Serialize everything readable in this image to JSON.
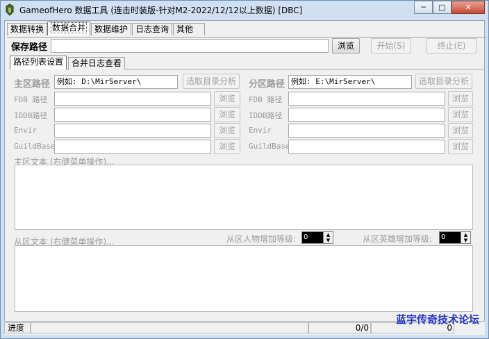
{
  "window": {
    "title": "GameofHero 数据工具 (连击时装版-针对M2-2022/12/12以上数据) [DBC]",
    "controls": {
      "minimize": "─",
      "maximize": "□",
      "close": "✕"
    }
  },
  "main_tabs": [
    "数据转换",
    "数据合并",
    "数据维护",
    "日志查询",
    "其他"
  ],
  "save_path": {
    "label": "保存路径",
    "value": "",
    "browse": "浏览",
    "start": "开始(S)",
    "stop": "终止(E)"
  },
  "sub_tabs": [
    "路径列表设置",
    "合并日志查看"
  ],
  "left": {
    "title": "主区路径",
    "path_value": "例如: D:\\MirServer\\",
    "analyze": "选取目录分析",
    "rows": [
      {
        "label": "FDB 路径",
        "browse": "浏览"
      },
      {
        "label": "IDDB路径",
        "browse": "浏览"
      },
      {
        "label": "Envir",
        "browse": "浏览"
      },
      {
        "label": "GuildBase",
        "browse": "浏览"
      }
    ]
  },
  "right": {
    "title": "分区路径",
    "path_value": "例如: E:\\MirServer\\",
    "analyze": "选取目录分析",
    "rows": [
      {
        "label": "FDB 路径",
        "browse": "浏览"
      },
      {
        "label": "IDDB路径",
        "browse": "浏览"
      },
      {
        "label": "Envir",
        "browse": "浏览"
      },
      {
        "label": "GuildBase",
        "browse": "浏览"
      }
    ]
  },
  "main_text_label": "主区文本 (右健菜单操作)...",
  "sub_text_label": "从区文本 (右健菜单操作)...",
  "player_level_label": "从区人物增加等级:",
  "hero_level_label": "从区英雄增加等级:",
  "player_level_value": "0",
  "hero_level_value": "0",
  "status": {
    "progress_label": "进度",
    "count": "0/0",
    "value": "0"
  },
  "watermark": "蓝宇传奇技术论坛"
}
